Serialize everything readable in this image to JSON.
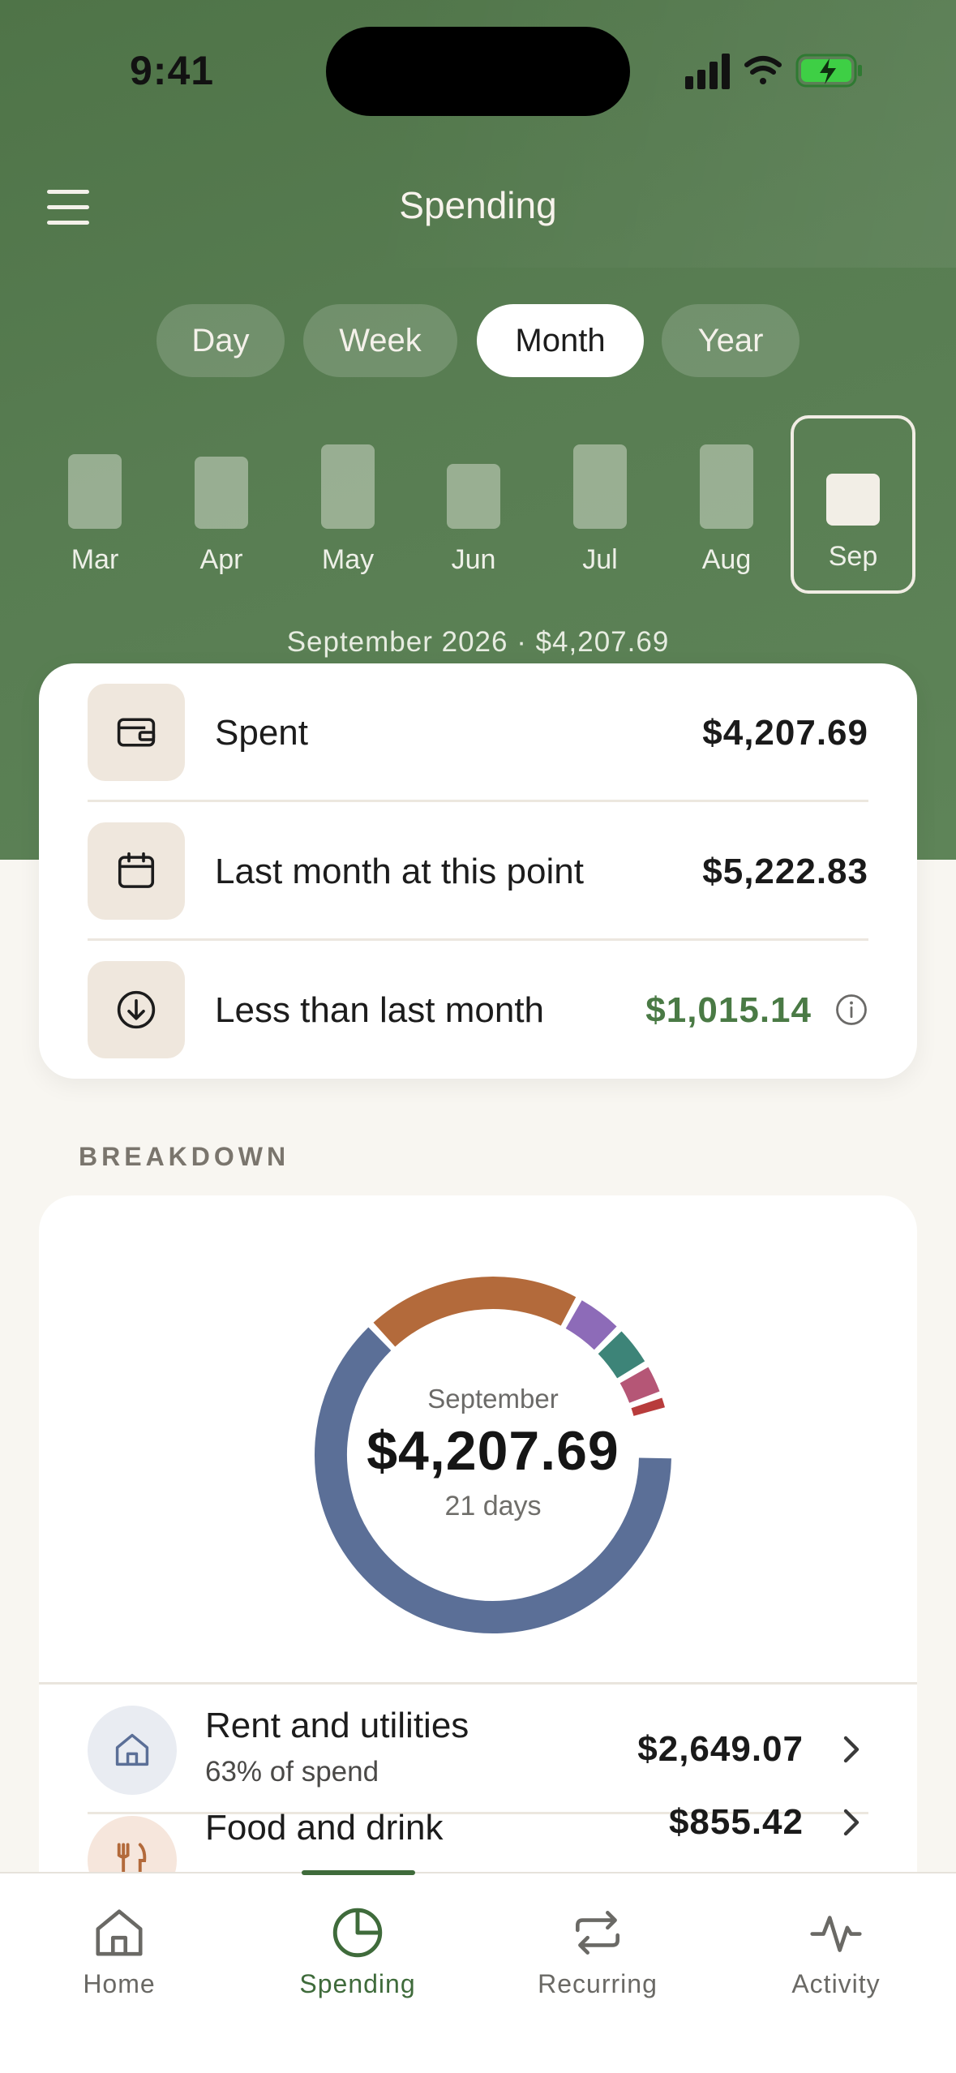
{
  "status_bar": {
    "time": "9:41",
    "icons": [
      "signal-icon",
      "wifi-icon",
      "battery-charging-icon"
    ],
    "battery_color": "#3ecf45"
  },
  "header": {
    "title": "Spending",
    "menu_icon": "hamburger-menu-icon"
  },
  "period_tabs": [
    {
      "label": "Day",
      "active": false
    },
    {
      "label": "Week",
      "active": false
    },
    {
      "label": "Month",
      "active": true
    },
    {
      "label": "Year",
      "active": false
    }
  ],
  "months": [
    {
      "label": "Mar",
      "level": 0.6
    },
    {
      "label": "Apr",
      "level": 0.58
    },
    {
      "label": "May",
      "level": 0.68
    },
    {
      "label": "Jun",
      "level": 0.52
    },
    {
      "label": "Jul",
      "level": 0.68
    },
    {
      "label": "Aug",
      "level": 0.68
    },
    {
      "label": "Sep",
      "level": 0.42,
      "selected": true
    }
  ],
  "period_summary": "September 2026 · $4,207.69",
  "summary": {
    "rows": [
      {
        "icon": "wallet-icon",
        "label": "Spent",
        "value": "$4,207.69"
      },
      {
        "icon": "calendar-icon",
        "label": "Last month at this point",
        "value": "$5,222.83"
      },
      {
        "icon": "arrow-down-circle-icon",
        "label": "Less than last month",
        "value": "$1,015.14",
        "value_color": "#4a7a45",
        "has_info": true
      }
    ]
  },
  "breakdown": {
    "section_label": "BREAKDOWN",
    "donut": {
      "month": "September",
      "amount": "$4,207.69",
      "days": "21 days"
    },
    "categories": [
      {
        "name": "Rent and utilities",
        "percent_text": "63% of spend",
        "amount": "$2,649.07",
        "icon": "house-icon",
        "icon_bg": "#e9ecf2",
        "icon_color": "#5b6f97"
      },
      {
        "name": "Food and drink",
        "percent_text": "",
        "amount": "$855.42",
        "icon": "utensils-icon",
        "icon_bg": "#f6e6dc",
        "icon_color": "#b36a3b"
      }
    ]
  },
  "chart_data": {
    "type": "pie",
    "style": "donut",
    "total": "$4,207.69",
    "segments": [
      {
        "share": 0.63,
        "color": "#5b6f97"
      },
      {
        "share": 0.2,
        "color": "#b36a3b"
      },
      {
        "share": 0.045,
        "color": "#8d6bb8"
      },
      {
        "share": 0.04,
        "color": "#3d8478"
      },
      {
        "share": 0.03,
        "color": "#b55676"
      },
      {
        "share": 0.015,
        "color": "#b83c3c"
      }
    ]
  },
  "tab_bar": {
    "items": [
      {
        "label": "Home",
        "icon": "home-icon",
        "active": false
      },
      {
        "label": "Spending",
        "icon": "pie-chart-icon",
        "active": true
      },
      {
        "label": "Recurring",
        "icon": "repeat-icon",
        "active": false
      },
      {
        "label": "Activity",
        "icon": "activity-icon",
        "active": false
      }
    ]
  },
  "colors": {
    "hero": "#557a4f",
    "accent_green": "#3f6b3b",
    "background": "#f8f6f1"
  }
}
